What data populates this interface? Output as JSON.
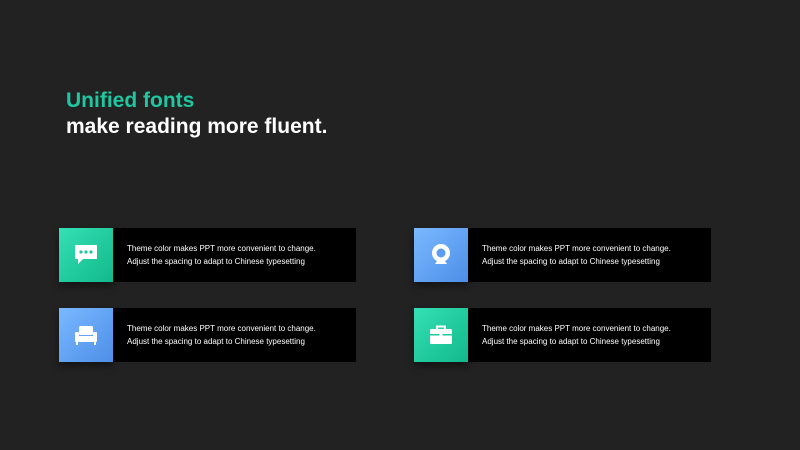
{
  "title": {
    "accent": "Unified fonts",
    "main": "make reading more fluent."
  },
  "colors": {
    "background": "#222222",
    "accent": "#1fc7a0",
    "card": "#000000",
    "green_icon": "#1fc7a0",
    "blue_icon": "#5e9cf0"
  },
  "cards": [
    {
      "icon": "chat-bubble-icon",
      "color": "green",
      "line1": "Theme  color makes PPT more convenient to change.",
      "line2": "Adjust the spacing to adapt to Chinese typesetting"
    },
    {
      "icon": "webcam-icon",
      "color": "blue",
      "line1": "Theme  color makes PPT more convenient to change.",
      "line2": "Adjust the spacing to adapt to Chinese typesetting"
    },
    {
      "icon": "sofa-icon",
      "color": "blue",
      "line1": "Theme  color makes PPT more convenient to change.",
      "line2": "Adjust the spacing to adapt to Chinese typesetting"
    },
    {
      "icon": "briefcase-icon",
      "color": "green",
      "line1": "Theme  color makes PPT more convenient to change.",
      "line2": "Adjust the spacing to adapt to Chinese typesetting"
    }
  ]
}
